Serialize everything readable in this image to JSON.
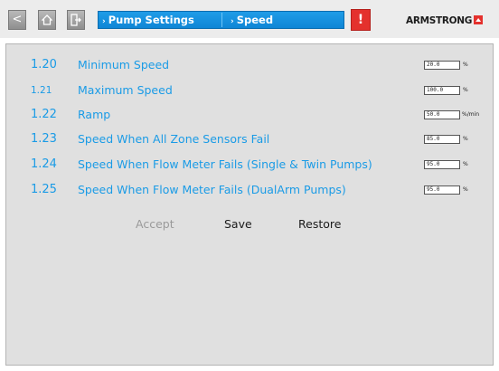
{
  "header": {
    "back_glyph": "<",
    "home_icon": "home-icon",
    "exit_icon": "exit-icon",
    "breadcrumb": [
      "Pump Settings",
      "Speed"
    ],
    "alert_glyph": "!",
    "brand": "ARMSTRONG",
    "accent_color": "#1a9be6",
    "alert_color": "#e4312d"
  },
  "settings": [
    {
      "number": "1.20",
      "label": "Minimum Speed",
      "value": "20.0",
      "unit": "%"
    },
    {
      "number": "1.21",
      "label": "Maximum Speed",
      "value": "100.0",
      "unit": "%"
    },
    {
      "number": "1.22",
      "label": "Ramp",
      "value": "50.0",
      "unit": "%/min"
    },
    {
      "number": "1.23",
      "label": "Speed When All Zone Sensors Fail",
      "value": "85.0",
      "unit": "%"
    },
    {
      "number": "1.24",
      "label": "Speed When Flow Meter Fails (Single & Twin Pumps)",
      "value": "95.0",
      "unit": "%"
    },
    {
      "number": "1.25",
      "label": "Speed When Flow Meter Fails (DualArm Pumps)",
      "value": "95.0",
      "unit": "%"
    }
  ],
  "actions": {
    "accept": "Accept",
    "save": "Save",
    "restore": "Restore"
  }
}
